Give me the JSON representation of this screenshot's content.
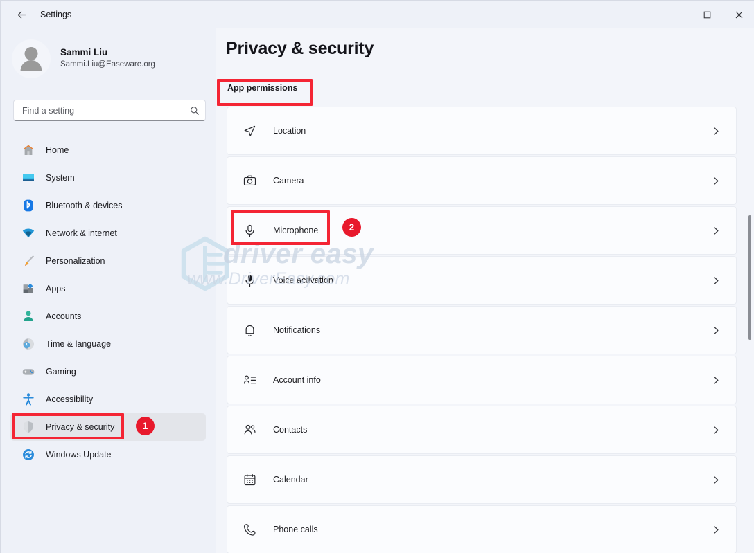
{
  "window": {
    "title": "Settings",
    "back_icon": "back-arrow-icon",
    "controls": {
      "minimize": "minimize-icon",
      "maximize": "maximize-icon",
      "close": "close-icon"
    }
  },
  "sidebar": {
    "profile": {
      "name": "Sammi Liu",
      "email": "Sammi.Liu@Easeware.org",
      "avatar": "person-avatar-icon"
    },
    "search": {
      "placeholder": "Find a setting",
      "value": "",
      "icon": "search-icon"
    },
    "items": [
      {
        "label": "Home",
        "icon": "home-icon",
        "selected": false
      },
      {
        "label": "System",
        "icon": "monitor-icon",
        "selected": false
      },
      {
        "label": "Bluetooth & devices",
        "icon": "bluetooth-icon",
        "selected": false
      },
      {
        "label": "Network & internet",
        "icon": "wifi-icon",
        "selected": false
      },
      {
        "label": "Personalization",
        "icon": "paintbrush-icon",
        "selected": false
      },
      {
        "label": "Apps",
        "icon": "apps-icon",
        "selected": false
      },
      {
        "label": "Accounts",
        "icon": "account-person-icon",
        "selected": false
      },
      {
        "label": "Time & language",
        "icon": "clock-globe-icon",
        "selected": false
      },
      {
        "label": "Gaming",
        "icon": "gamepad-icon",
        "selected": false
      },
      {
        "label": "Accessibility",
        "icon": "accessibility-person-icon",
        "selected": false
      },
      {
        "label": "Privacy & security",
        "icon": "shield-icon",
        "selected": true
      },
      {
        "label": "Windows Update",
        "icon": "update-refresh-icon",
        "selected": false
      }
    ]
  },
  "main": {
    "page_title": "Privacy & security",
    "section_header": "App permissions",
    "permissions": [
      {
        "label": "Location",
        "icon": "location-arrow-icon",
        "chevron": "chevron-right-icon"
      },
      {
        "label": "Camera",
        "icon": "camera-icon",
        "chevron": "chevron-right-icon"
      },
      {
        "label": "Microphone",
        "icon": "microphone-icon",
        "chevron": "chevron-right-icon"
      },
      {
        "label": "Voice activation",
        "icon": "microphone-voice-icon",
        "chevron": "chevron-right-icon"
      },
      {
        "label": "Notifications",
        "icon": "bell-icon",
        "chevron": "chevron-right-icon"
      },
      {
        "label": "Account info",
        "icon": "account-info-icon",
        "chevron": "chevron-right-icon"
      },
      {
        "label": "Contacts",
        "icon": "contacts-icon",
        "chevron": "chevron-right-icon"
      },
      {
        "label": "Calendar",
        "icon": "calendar-icon",
        "chevron": "chevron-right-icon"
      },
      {
        "label": "Phone calls",
        "icon": "phone-icon",
        "chevron": "chevron-right-icon"
      }
    ]
  },
  "watermark": {
    "text": "driver easy",
    "subtext": "www.DriverEasy.com",
    "logo": "driver-easy-hexagon-logo"
  },
  "annotations": {
    "accent_color": "#f42534",
    "badge_color": "#e8192c",
    "steps": [
      {
        "number": "1",
        "target": "Privacy & security"
      },
      {
        "number": "2",
        "target": "Microphone"
      }
    ],
    "boxes": [
      {
        "target": "App permissions"
      },
      {
        "target": "Microphone"
      },
      {
        "target": "Privacy & security"
      }
    ]
  }
}
